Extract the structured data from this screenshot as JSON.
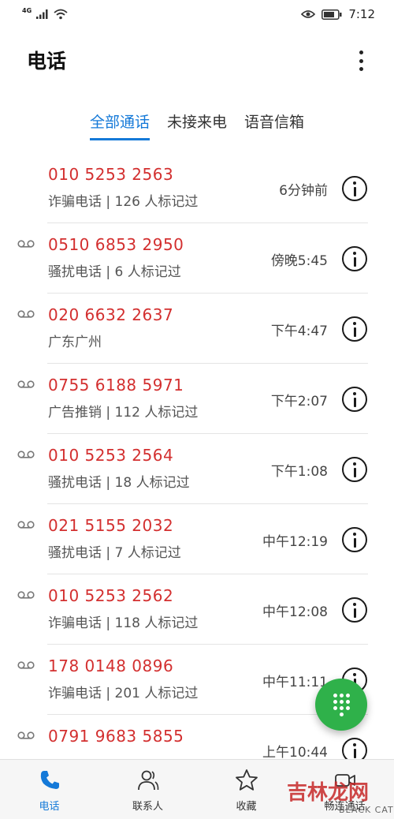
{
  "status_bar": {
    "network": "4G",
    "time": "7:12"
  },
  "header": {
    "title": "电话"
  },
  "tabs": [
    {
      "label": "全部通话",
      "active": true
    },
    {
      "label": "未接来电",
      "active": false
    },
    {
      "label": "语音信箱",
      "active": false
    }
  ],
  "calls": [
    {
      "number": "010 5253 2563",
      "tag": "诈骗电话 | 126 人标记过",
      "time": "6分钟前",
      "voicemail": false
    },
    {
      "number": "0510 6853 2950",
      "tag": "骚扰电话 | 6 人标记过",
      "time": "傍晚5:45",
      "voicemail": true
    },
    {
      "number": "020 6632 2637",
      "tag": "广东广州",
      "time": "下午4:47",
      "voicemail": true
    },
    {
      "number": "0755 6188 5971",
      "tag": "广告推销 | 112 人标记过",
      "time": "下午2:07",
      "voicemail": true
    },
    {
      "number": "010 5253 2564",
      "tag": "骚扰电话 | 18 人标记过",
      "time": "下午1:08",
      "voicemail": true
    },
    {
      "number": "021 5155 2032",
      "tag": "骚扰电话 | 7 人标记过",
      "time": "中午12:19",
      "voicemail": true
    },
    {
      "number": "010 5253 2562",
      "tag": "诈骗电话 | 118 人标记过",
      "time": "中午12:08",
      "voicemail": true
    },
    {
      "number": "178 0148 0896",
      "tag": "诈骗电话 | 201 人标记过",
      "time": "中午11:11",
      "voicemail": true
    },
    {
      "number": "0791 9683 5855",
      "tag": "",
      "time": "上午10:44",
      "voicemail": true
    }
  ],
  "bottom_nav": [
    {
      "label": "电话",
      "icon": "phone-icon",
      "active": true
    },
    {
      "label": "联系人",
      "icon": "contacts-icon",
      "active": false
    },
    {
      "label": "收藏",
      "icon": "star-icon",
      "active": false
    },
    {
      "label": "畅连通话",
      "icon": "video-call-icon",
      "active": false
    }
  ],
  "watermark": {
    "text": "吉林龙网",
    "sub": "BLACK CAT"
  },
  "colors": {
    "accent": "#1479d8",
    "number_red": "#d32f2f",
    "fab_green": "#2fb14a"
  }
}
